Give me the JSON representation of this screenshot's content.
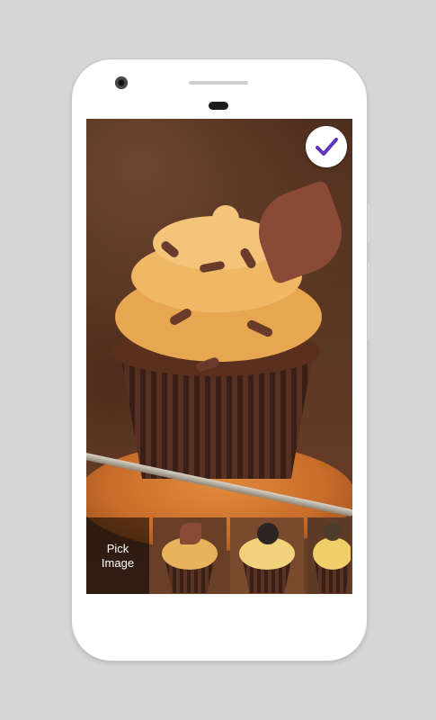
{
  "app": {
    "confirm_icon": "checkmark-icon",
    "accent_color": "#5b39b8",
    "pick_image": {
      "line1": "Pick",
      "line2": "Image"
    },
    "thumbnails": [
      {
        "name": "cupcake-thumbnail-1",
        "frost_color": "#e9b35e",
        "topper_color": "#8a4a35",
        "bg_color": "#6a3f27"
      },
      {
        "name": "cupcake-thumbnail-2",
        "frost_color": "#f2d27c",
        "topper_color": "#2d2522",
        "bg_color": "#7a4a2e"
      },
      {
        "name": "cupcake-thumbnail-3",
        "frost_color": "#f0cf6a",
        "topper_color": "#4b3c2c",
        "bg_color": "#5e3b26"
      }
    ]
  }
}
